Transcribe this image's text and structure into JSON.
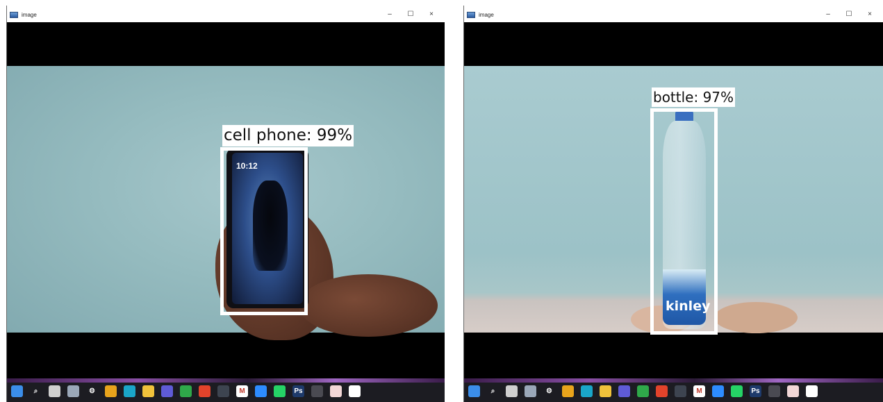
{
  "windows": [
    {
      "title": "image",
      "controls": {
        "minimize": "–",
        "maximize": "☐",
        "close": "×"
      },
      "detection": {
        "label": "cell phone: 99%",
        "object": "cell phone",
        "confidence": "99%"
      },
      "phone_screen_clock": "10:12"
    },
    {
      "title": "image",
      "controls": {
        "minimize": "–",
        "maximize": "☐",
        "close": "×"
      },
      "detection": {
        "label": "bottle: 97%",
        "object": "bottle",
        "confidence": "97%"
      },
      "bottle_brand": "kinley"
    }
  ],
  "taskbar_icons": [
    {
      "name": "windows-start",
      "color": "#3b8eea",
      "glyph": ""
    },
    {
      "name": "search",
      "color": "#1c1c22",
      "glyph": "⌕"
    },
    {
      "name": "task-view",
      "color": "#cfcfcf",
      "glyph": ""
    },
    {
      "name": "widgets",
      "color": "#9aa7b8",
      "glyph": ""
    },
    {
      "name": "settings",
      "color": "#1c1c22",
      "glyph": "⚙"
    },
    {
      "name": "chrome",
      "color": "#e8a41c",
      "glyph": ""
    },
    {
      "name": "edge",
      "color": "#1aa6c9",
      "glyph": ""
    },
    {
      "name": "file-explorer",
      "color": "#f0c23b",
      "glyph": ""
    },
    {
      "name": "visual-studio",
      "color": "#5f5bd6",
      "glyph": ""
    },
    {
      "name": "xbox",
      "color": "#2fa84a",
      "glyph": ""
    },
    {
      "name": "office",
      "color": "#e2432b",
      "glyph": ""
    },
    {
      "name": "steam",
      "color": "#3d4450",
      "glyph": ""
    },
    {
      "name": "gmail",
      "color": "#ffffff",
      "glyph": "M"
    },
    {
      "name": "zoom",
      "color": "#2d8cff",
      "glyph": ""
    },
    {
      "name": "whatsapp",
      "color": "#25d366",
      "glyph": ""
    },
    {
      "name": "photoshop",
      "color": "#1e3a6b",
      "glyph": "Ps"
    },
    {
      "name": "terminal",
      "color": "#4a4a52",
      "glyph": ""
    },
    {
      "name": "paint",
      "color": "#f2d7d7",
      "glyph": ""
    },
    {
      "name": "notepad",
      "color": "#ffffff",
      "glyph": ""
    }
  ]
}
